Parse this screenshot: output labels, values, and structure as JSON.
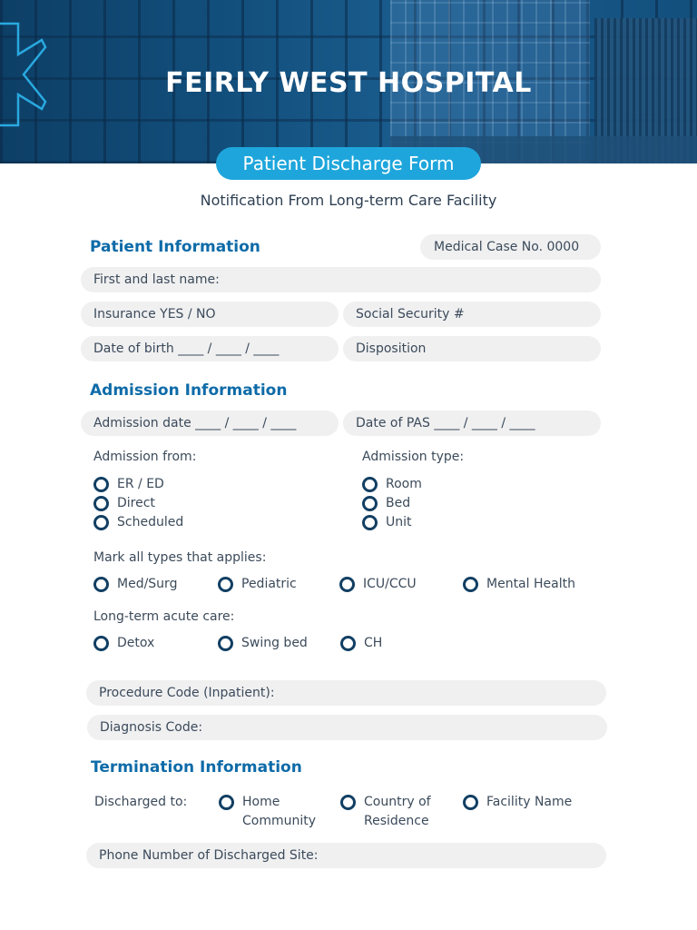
{
  "header": {
    "hospital_name": "FEIRLY WEST HOSPITAL",
    "form_title": "Patient Discharge Form",
    "subtitle": "Notification From Long-term Care Facility",
    "logo_icon": "star-of-life-icon"
  },
  "colors": {
    "accent": "#1ea6dc",
    "heading": "#0e6ba8",
    "radio": "#123f63",
    "field_bg": "#f0f0f1",
    "banner": "#13507e"
  },
  "patient": {
    "title": "Patient Information",
    "case_no": "Medical Case No. 0000",
    "name": "First and last name:",
    "insurance": "Insurance  YES  /  NO",
    "ssn": "Social Security #",
    "dob": "Date of birth ____ / ____ / ____",
    "disposition": "Disposition"
  },
  "admission": {
    "title": "Admission Information",
    "date": "Admission date ____ / ____ / ____",
    "pas_date": "Date of PAS ____ / ____ / ____",
    "from_label": "Admission from:",
    "from_options": [
      "ER / ED",
      "Direct",
      "Scheduled"
    ],
    "type_label": "Admission type:",
    "type_options": [
      "Room",
      "Bed",
      "Unit"
    ],
    "mark_label": "Mark all types that applies:",
    "mark_options": [
      "Med/Surg",
      "Pediatric",
      "ICU/CCU",
      "Mental Health"
    ],
    "ltac_label": "Long-term acute care:",
    "ltac_options": [
      "Detox",
      "Swing bed",
      "CH"
    ],
    "procedure_code": "Procedure Code (Inpatient):",
    "diagnosis_code": "Diagnosis Code:"
  },
  "termination": {
    "title": "Termination Information",
    "discharged_label": "Discharged to:",
    "options": [
      {
        "line1": "Home",
        "line2": "Community"
      },
      {
        "line1": "Country of",
        "line2": "Residence"
      },
      {
        "line1": "Facility Name",
        "line2": ""
      }
    ],
    "phone": "Phone Number of Discharged Site:"
  }
}
